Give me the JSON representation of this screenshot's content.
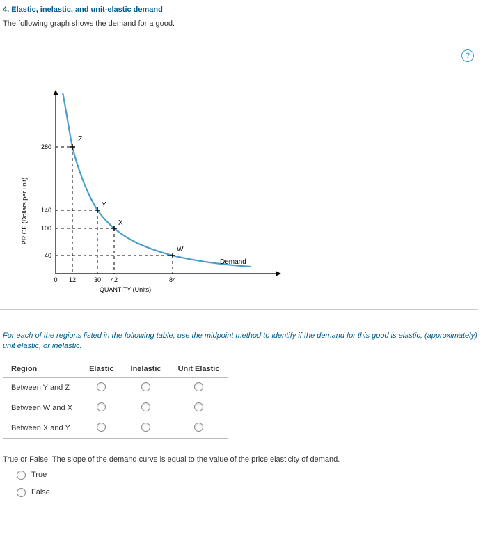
{
  "heading": "4. Elastic, inelastic, and unit-elastic demand",
  "intro": "The following graph shows the demand for a good.",
  "help_label": "?",
  "chart_data": {
    "type": "line",
    "xlabel": "QUANTITY (Units)",
    "ylabel": "PRICE (Dollars per unit)",
    "xlim": [
      0,
      160
    ],
    "ylim": [
      0,
      400
    ],
    "x_ticks": [
      0,
      12,
      30,
      42,
      84
    ],
    "y_ticks": [
      40,
      100,
      140,
      280
    ],
    "series": [
      {
        "name": "Demand",
        "points": [
          [
            5,
            400
          ],
          [
            12,
            280
          ],
          [
            20,
            180
          ],
          [
            30,
            140
          ],
          [
            42,
            100
          ],
          [
            60,
            60
          ],
          [
            84,
            40
          ],
          [
            140,
            15
          ]
        ]
      }
    ],
    "marked_points": [
      {
        "label": "Z",
        "x": 12,
        "y": 280
      },
      {
        "label": "Y",
        "x": 30,
        "y": 140
      },
      {
        "label": "X",
        "x": 42,
        "y": 100
      },
      {
        "label": "W",
        "x": 84,
        "y": 40
      }
    ]
  },
  "instructions": "For each of the regions listed in the following table, use the midpoint method to identify if the demand for this good is elastic, (approximately) unit elastic, or inelastic.",
  "table": {
    "headers": [
      "Region",
      "Elastic",
      "Inelastic",
      "Unit Elastic"
    ],
    "rows": [
      {
        "region": "Between Y and Z"
      },
      {
        "region": "Between W and X"
      },
      {
        "region": "Between X and Y"
      }
    ]
  },
  "tf": {
    "question": "True or False: The slope of the demand curve is equal to the value of the price elasticity of demand.",
    "options": [
      "True",
      "False"
    ]
  }
}
